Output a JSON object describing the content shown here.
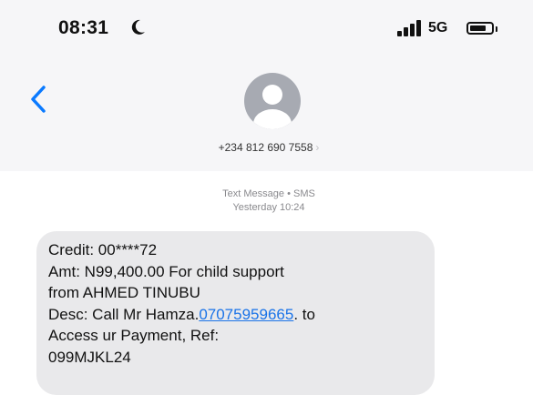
{
  "status_bar": {
    "time": "08:31",
    "network": "5G",
    "icons": [
      "moon-icon",
      "signal-icon",
      "battery-icon"
    ]
  },
  "header": {
    "back_icon": "chevron-left-icon",
    "contact_number": "+234 812 690 7558",
    "contact_chevron": "›",
    "avatar_icon": "person-icon"
  },
  "thread": {
    "service_label": "Text Message • SMS",
    "timestamp": "Yesterday 10:24"
  },
  "message": {
    "line1": "Credit: 00****72",
    "line2": "Amt: N99,400.00 For child support",
    "line3": "from AHMED TINUBU",
    "line4_prefix": "Desc: Call Mr Hamza.",
    "line4_link": "07075959665",
    "line4_suffix": ". to",
    "line5": "Access ur Payment, Ref:",
    "line6": "099MJKL24"
  },
  "colors": {
    "header_bg": "#f6f6f8",
    "bubble_bg": "#e9e9eb",
    "link": "#1a73e8",
    "accent": "#0a7aff",
    "avatar": "#a7aab2"
  }
}
